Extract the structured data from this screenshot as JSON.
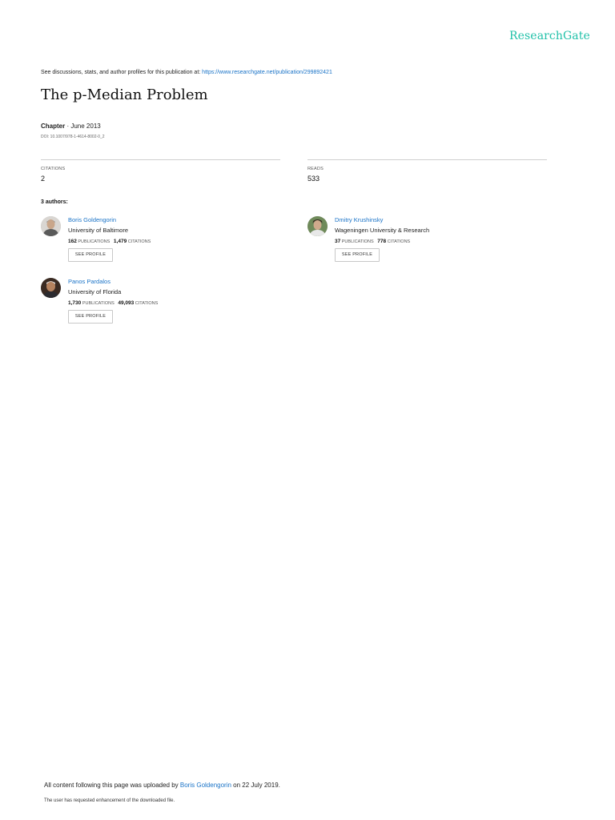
{
  "brand": "ResearchGate",
  "header": {
    "discussion_text": "See discussions, stats, and author profiles for this publication at: ",
    "publication_url": "https://www.researchgate.net/publication/299892421"
  },
  "publication": {
    "title": "The p-Median Problem",
    "type": "Chapter",
    "separator": " · ",
    "date": "June 2013",
    "doi": "DOI: 10.1007/978-1-4614-8002-0_2"
  },
  "stats": {
    "citations_label": "CITATIONS",
    "citations": "2",
    "reads_label": "READS",
    "reads": "533"
  },
  "authors_heading": "3 authors:",
  "authors": [
    {
      "name": "Boris Goldengorin",
      "institution": "University of Baltimore",
      "publications": "162",
      "publications_label": "PUBLICATIONS",
      "citations": "1,479",
      "citations_label": "CITATIONS",
      "button": "SEE PROFILE"
    },
    {
      "name": "Dmitry Krushinsky",
      "institution": "Wageningen University & Research",
      "publications": "37",
      "publications_label": "PUBLICATIONS",
      "citations": "778",
      "citations_label": "CITATIONS",
      "button": "SEE PROFILE"
    },
    {
      "name": "Panos Pardalos",
      "institution": "University of Florida",
      "publications": "1,730",
      "publications_label": "PUBLICATIONS",
      "citations": "49,093",
      "citations_label": "CITATIONS",
      "button": "SEE PROFILE"
    }
  ],
  "footer": {
    "uploaded_prefix": "All content following this page was uploaded by ",
    "uploader": "Boris Goldengorin",
    "uploaded_suffix": " on 22 July 2019.",
    "note": "The user has requested enhancement of the downloaded file."
  },
  "colors": {
    "brand": "#21c1a9",
    "link": "#1a73c7"
  }
}
